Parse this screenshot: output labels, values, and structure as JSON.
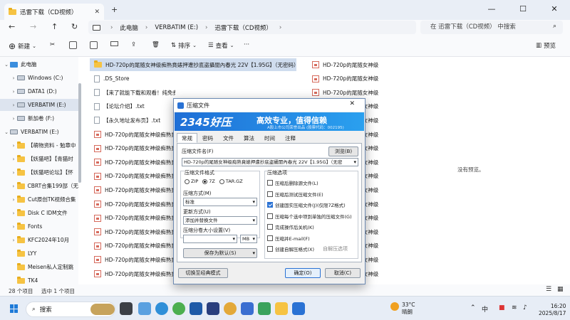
{
  "window": {
    "tab_title": "迅雷下载（CD视频）",
    "new_tab": "+",
    "controls": [
      "—",
      "☐",
      "✕"
    ]
  },
  "address": {
    "crumbs": [
      "此电脑",
      "VERBATIM (E:)",
      "迅雷下载（CD视频）"
    ],
    "search_placeholder": "在 迅雷下载（CD视频） 中搜索"
  },
  "toolbar": {
    "new_label": "新建",
    "sort_label": "排序",
    "view_label": "查看",
    "preview_label": "预览"
  },
  "sidebar": {
    "items": [
      {
        "label": "此电脑",
        "kind": "pc",
        "indent": 0,
        "chev": "⌄"
      },
      {
        "label": "Windows (C:)",
        "kind": "drive",
        "indent": 1,
        "chev": "›"
      },
      {
        "label": "DATA1 (D:)",
        "kind": "drive",
        "indent": 1,
        "chev": "›"
      },
      {
        "label": "VERBATIM (E:)",
        "kind": "drive",
        "indent": 1,
        "chev": "›",
        "selected": true
      },
      {
        "label": "新加卷 (F:)",
        "kind": "drive",
        "indent": 1,
        "chev": "›"
      },
      {
        "label": "VERBATIM (E:)",
        "kind": "drive",
        "indent": 0,
        "chev": "⌄"
      },
      {
        "label": "【萌物资料 - 勉章中",
        "kind": "folder",
        "indent": 1,
        "chev": "›"
      },
      {
        "label": "【妖猫吧】【青猫时",
        "kind": "folder",
        "indent": 1,
        "chev": "›"
      },
      {
        "label": "【妖猫吧论坛】【怀",
        "kind": "folder",
        "indent": 1,
        "chev": "›"
      },
      {
        "label": "CBRT合集199部（无",
        "kind": "folder",
        "indent": 1,
        "chev": "›"
      },
      {
        "label": "Cut原创TK视频合集",
        "kind": "folder",
        "indent": 1,
        "chev": "›"
      },
      {
        "label": "Disk C IDM文件",
        "kind": "folder",
        "indent": 1,
        "chev": "›"
      },
      {
        "label": "Fonts",
        "kind": "folder",
        "indent": 1,
        "chev": "›"
      },
      {
        "label": "KFC2024年10月",
        "kind": "folder",
        "indent": 1,
        "chev": "›"
      },
      {
        "label": "LYY",
        "kind": "folder",
        "indent": 1,
        "chev": ""
      },
      {
        "label": "Meisen私人定制跳",
        "kind": "folder",
        "indent": 1,
        "chev": ""
      },
      {
        "label": "TK4",
        "kind": "folder",
        "indent": 1,
        "chev": ""
      }
    ]
  },
  "files": {
    "left_column": [
      {
        "name": "HD-720p的尾随女神级痴熟賁婊押遭抄底盗攝閨內春光 22V【1.95G】（无密码）",
        "kind": "folder",
        "selected": true
      },
      {
        "name": ".DS_Store",
        "kind": "file"
      },
      {
        "name": "【来了就能下载和观看！纯免费！】.txt",
        "kind": "file"
      },
      {
        "name": "【论坛介绍】.txt",
        "kind": "file"
      },
      {
        "name": "【永久地址发布页】.txt",
        "kind": "file"
      },
      {
        "name": "HD-720p的尾随女神级痴熟賁婊",
        "kind": "rar"
      },
      {
        "name": "HD-720p的尾随女神级痴熟賁婊",
        "kind": "rar"
      },
      {
        "name": "HD-720p的尾随女神级痴熟賁婊",
        "kind": "rar"
      },
      {
        "name": "HD-720p的尾随女神级痴熟賁婊",
        "kind": "rar"
      },
      {
        "name": "HD-720p的尾随女神级痴熟賁婊",
        "kind": "rar"
      },
      {
        "name": "HD-720p的尾随女神级痴熟賁婊",
        "kind": "rar"
      },
      {
        "name": "HD-720p的尾随女神级痴熟賁婊",
        "kind": "rar"
      },
      {
        "name": "HD-720p的尾随女神级痴熟賁婊",
        "kind": "rar"
      },
      {
        "name": "HD-720p的尾随女神级痴熟賁婊",
        "kind": "rar"
      },
      {
        "name": "HD-720p的尾随女神级痴熟賁婊",
        "kind": "rar"
      },
      {
        "name": "HD-720p的尾随女神级痴熟賁婊",
        "kind": "rar"
      }
    ],
    "right_column": [
      {
        "name": "HD-720p的尾随女神级",
        "kind": "rar"
      },
      {
        "name": "HD-720p的尾随女神级",
        "kind": "rar"
      },
      {
        "name": "HD-720p的尾随女神级",
        "kind": "rar"
      },
      {
        "name": "HD-720p的尾随女神级",
        "kind": "rar"
      },
      {
        "name": "HD-720p的尾随女神级",
        "kind": "rar"
      },
      {
        "name": "HD-720p的尾随女神级",
        "kind": "rar"
      },
      {
        "name": "HD-720p的尾随女神级",
        "kind": "rar"
      },
      {
        "name": "HD-720p的尾随女神级",
        "kind": "rar"
      },
      {
        "name": "HD-720p的尾随女神级",
        "kind": "rar"
      },
      {
        "name": "HD-720p的尾随女神级",
        "kind": "rar"
      },
      {
        "name": "HD-720p的尾随女神级",
        "kind": "rar"
      },
      {
        "name": "HD-720p的尾随女神级",
        "kind": "rar"
      },
      {
        "name": "HD-720p的尾随女神级",
        "kind": "rar"
      },
      {
        "name": "HD-720p的尾随女神级",
        "kind": "rar"
      },
      {
        "name": "HD-720p的尾随女神级",
        "kind": "rar"
      },
      {
        "name": "HD-720p的尾随女神级",
        "kind": "rar"
      }
    ]
  },
  "preview_pane": {
    "text": "没有预览。"
  },
  "status": {
    "count": "28 个项目",
    "selected": "选中 1 个项目"
  },
  "dialog": {
    "title": "压缩文件",
    "banner_logo": "2345好压",
    "banner_slogan": "高效专业，值得信赖",
    "banner_sub": "A股上市公司荣誉出品 (股票代码：002195)",
    "tabs": [
      "常规",
      "密码",
      "文件",
      "算法",
      "时间",
      "注释"
    ],
    "filename_label": "压缩文件名(F)",
    "browse_label": "浏览(B)",
    "filename_value": "HD-720p的尾随女神级痴熟賁婊押遭抄底盗攝閨內春光 22V【1.95G】（无密",
    "format_label": "压缩文件格式",
    "formats": [
      "ZIP",
      "7Z",
      "TAR.GZ"
    ],
    "format_selected": "7Z",
    "method_label": "压缩方式(M)",
    "method_value": "标准",
    "update_label": "更新方式(U)",
    "update_value": "添加并替换文件",
    "split_label": "压缩分卷大小设置(V)",
    "split_unit": "MB",
    "save_default_label": "保存为默认(S)",
    "options_label": "压缩选项",
    "options": [
      {
        "label": "压缩后删除源文件(L)",
        "checked": false
      },
      {
        "label": "压缩后测试压缩文件(E)",
        "checked": false
      },
      {
        "label": "创建固实压缩文件(J)(仅限7Z格式)",
        "checked": true
      },
      {
        "label": "压缩每个选中项到单独的压缩文件(G)",
        "checked": false
      },
      {
        "label": "完成操作后关机(K)",
        "checked": false
      },
      {
        "label": "压缩并E-mail(F)",
        "checked": false
      },
      {
        "label": "创建自解压格式(X)",
        "checked": false
      }
    ],
    "sfx_option_label": "自解压选项",
    "classic_mode_label": "切换至经典模式",
    "ok_label": "确定(O)",
    "cancel_label": "取消(C)"
  },
  "taskbar": {
    "search_label": "搜索",
    "weather_temp": "33°C",
    "weather_desc": "晴朗",
    "time": "16:20",
    "date": "2025/8/17"
  }
}
